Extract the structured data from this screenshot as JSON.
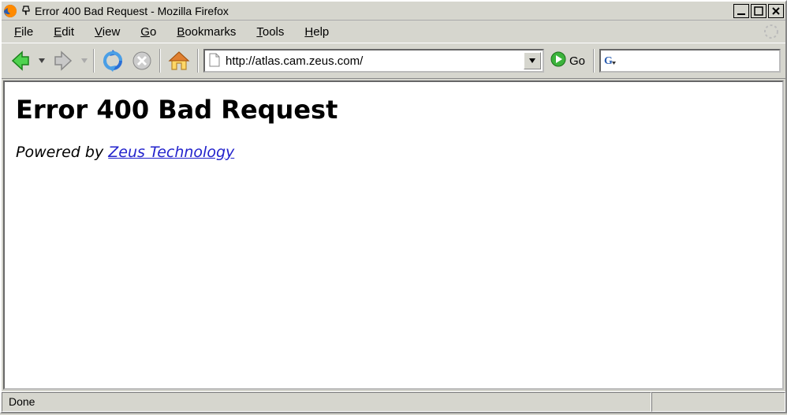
{
  "window": {
    "title": "Error 400 Bad Request - Mozilla Firefox"
  },
  "menu": {
    "file": "File",
    "edit": "Edit",
    "view": "View",
    "go": "Go",
    "bookmarks": "Bookmarks",
    "tools": "Tools",
    "help": "Help"
  },
  "toolbar": {
    "url_value": "http://atlas.cam.zeus.com/",
    "go_label": "Go",
    "search_value": ""
  },
  "page": {
    "heading": "Error 400 Bad Request",
    "powered_prefix": "Powered by ",
    "powered_link": "Zeus Technology"
  },
  "status": {
    "text": "Done"
  },
  "icons": {
    "back": "back-icon",
    "forward": "forward-icon",
    "reload": "reload-icon",
    "stop": "stop-icon",
    "home": "home-icon",
    "page": "page-icon",
    "go": "go-icon",
    "search_engine": "google-icon"
  }
}
